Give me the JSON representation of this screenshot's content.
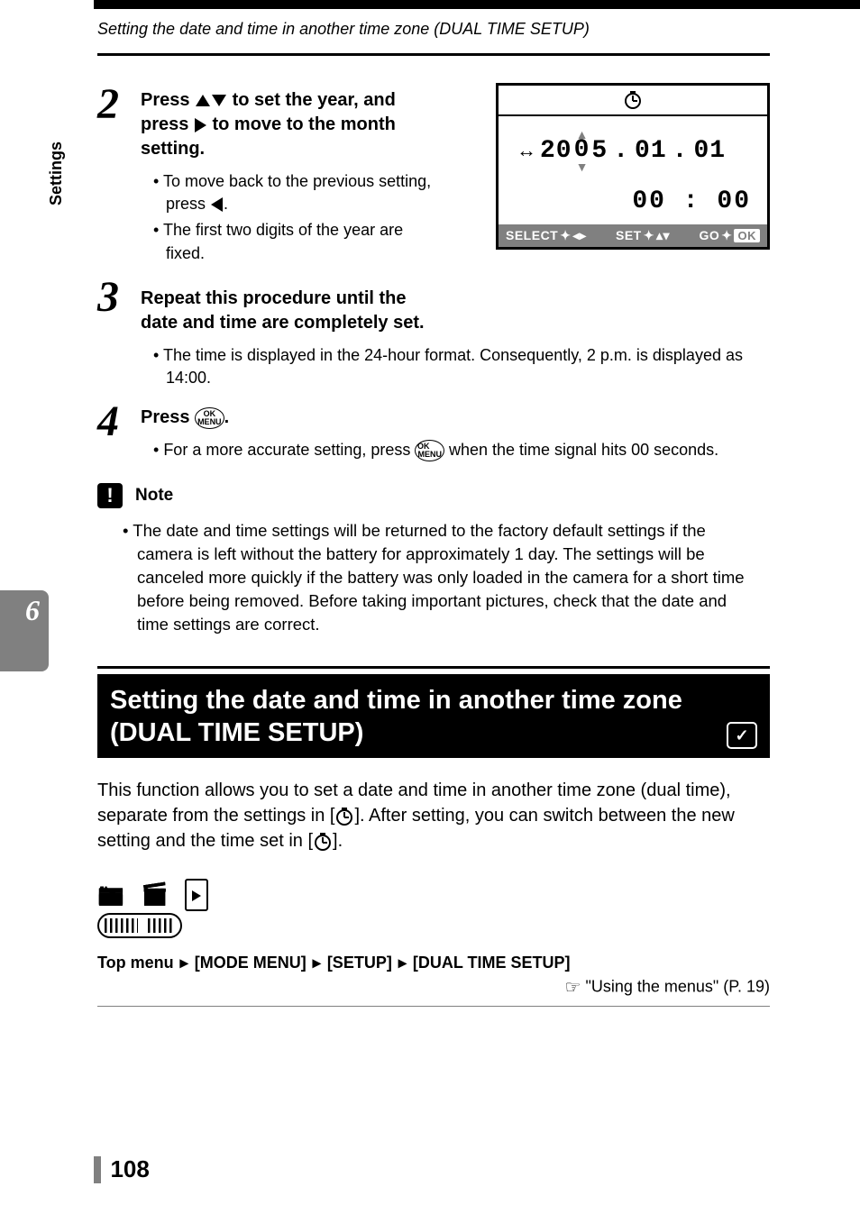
{
  "header": {
    "running_head": "Setting the date and time in another time zone (DUAL TIME SETUP)"
  },
  "steps": {
    "s2": {
      "num": "2",
      "instruction_a": "Press",
      "instruction_b": "to set the year, and press",
      "instruction_c": "to move to the month setting.",
      "bullet1_a": "To move back to the previous setting, press",
      "bullet1_b": ".",
      "bullet2": "The first two digits of the year are fixed."
    },
    "s3": {
      "num": "3",
      "instruction": "Repeat this procedure until the date and time are completely set.",
      "bullet1": "The time is displayed in the 24-hour format. Consequently, 2 p.m. is displayed as 14:00."
    },
    "s4": {
      "num": "4",
      "instruction_a": "Press",
      "instruction_b": ".",
      "bullet1_a": "For a more accurate setting, press",
      "bullet1_b": "when the time signal hits 00 seconds."
    }
  },
  "lcd": {
    "year_prefix": "20",
    "year_editable": "0",
    "year_suffix": "5",
    "sep": ".",
    "month": "01",
    "day": "01",
    "time": "00 : 00",
    "footer_select": "SELECT",
    "footer_set": "SET",
    "footer_go": "GO",
    "footer_ok": "OK"
  },
  "note": {
    "label": "Note",
    "body": "The date and time settings will be returned to the factory default settings if the camera is left without the battery for approximately 1 day. The settings will be canceled more quickly if the battery was only loaded in the camera for a short time before being removed. Before taking important pictures, check that the date and time settings are correct."
  },
  "section": {
    "title": "Setting the date and time in another time zone (DUAL TIME SETUP)",
    "body_a": "This function allows you to set a date and time in another time zone (dual time), separate from the settings in [",
    "body_b": "]. After setting, you can switch between the new setting and the time set in [",
    "body_c": "]."
  },
  "breadcrumb": {
    "prefix": "Top menu",
    "item1": "[MODE MENU]",
    "item2": "[SETUP]",
    "item3": "[DUAL TIME SETUP]",
    "ref": "\"Using the menus\" (P. 19)"
  },
  "sidetab": {
    "num": "6",
    "label": "Settings"
  },
  "page_number": "108"
}
